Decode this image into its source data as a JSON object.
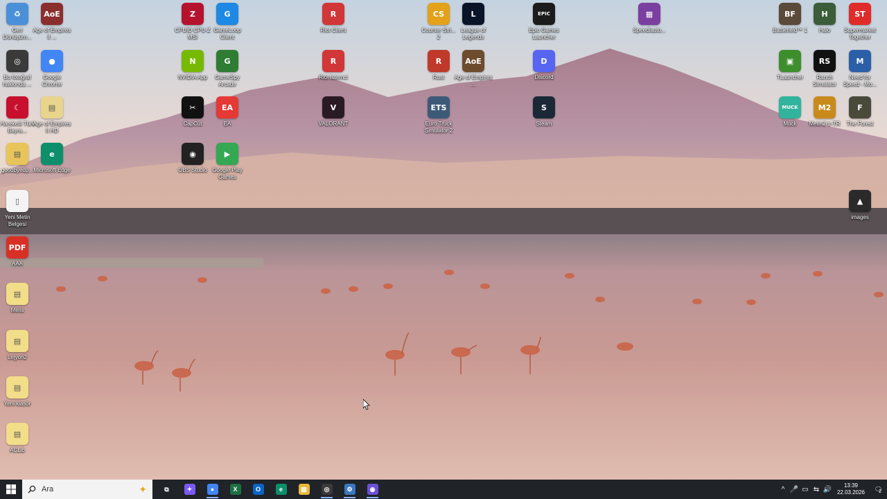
{
  "desktop_icons": [
    {
      "label": "Geri Dönüşüm...",
      "glyph": "♻",
      "color": "#4a90d9"
    },
    {
      "label": "Age of Empires II ...",
      "glyph": "AoE",
      "color": "#8b2e2e"
    },
    {
      "label": "CPUID CPU-Z MSI",
      "glyph": "Z",
      "color": "#b5122e"
    },
    {
      "label": "GameLoop Client",
      "glyph": "G",
      "color": "#1e88e5"
    },
    {
      "label": "Riot Client",
      "glyph": "R",
      "color": "#d13639"
    },
    {
      "label": "Counter Stri... 2",
      "glyph": "CS",
      "color": "#e3a21a"
    },
    {
      "label": "League of Legends",
      "glyph": "L",
      "color": "#0a1428"
    },
    {
      "label": "Epic Games Launcher",
      "glyph": "EPIC",
      "color": "#1b1b1b"
    },
    {
      "label": "Speedlauto...",
      "glyph": "▦",
      "color": "#7b3fa0"
    },
    {
      "label": "Battlefield™ 1",
      "glyph": "BF",
      "color": "#5b4a3a"
    },
    {
      "label": "Halo",
      "glyph": "H",
      "color": "#3b5d3a"
    },
    {
      "label": "Supermarket Together",
      "glyph": "ST",
      "color": "#e02b2b"
    },
    {
      "label": "Bu fotoğraf hakkında ...",
      "glyph": "◎",
      "color": "#3a3a3a"
    },
    {
      "label": "Google Chrome",
      "glyph": "●",
      "color": "#4285f4"
    },
    {
      "label": "NVIDIA App",
      "glyph": "N",
      "color": "#76b900"
    },
    {
      "label": "GameSpy Arcade",
      "glyph": "G",
      "color": "#2e7d32"
    },
    {
      "label": "Riot Istemci",
      "glyph": "R",
      "color": "#d13639"
    },
    {
      "label": "Rust",
      "glyph": "R",
      "color": "#c0392b"
    },
    {
      "label": "Age of Empires ...",
      "glyph": "AoE",
      "color": "#6d4c2e"
    },
    {
      "label": "Discord",
      "glyph": "D",
      "color": "#5865f2"
    },
    {
      "label": "TLauncher",
      "glyph": "▣",
      "color": "#3e8e2e"
    },
    {
      "label": "Ranch Simulator",
      "glyph": "RS",
      "color": "#111111"
    },
    {
      "label": "Need for Speed - Mo...",
      "glyph": "M",
      "color": "#2b5fa8"
    },
    {
      "label": "Hareketli Türk Bayra...",
      "glyph": "☾",
      "color": "#c8102e"
    },
    {
      "label": "Age of Empires II HD",
      "glyph": "▤",
      "color": "#e8d48b"
    },
    {
      "label": "CapCut",
      "glyph": "✂",
      "color": "#111111"
    },
    {
      "label": "EA",
      "glyph": "EA",
      "color": "#e53935"
    },
    {
      "label": "VALORANT",
      "glyph": "V",
      "color": "#2a1a24"
    },
    {
      "label": "Euro Truck Simulator 2",
      "glyph": "ETS",
      "color": "#3c5a78"
    },
    {
      "label": "Steam",
      "glyph": "S",
      "color": "#1b2838"
    },
    {
      "label": "Muck",
      "glyph": "MUCK",
      "color": "#31b39d"
    },
    {
      "label": "Metin2-tr-TR",
      "glyph": "M2",
      "color": "#c98a1c"
    },
    {
      "label": "The Forest",
      "glyph": "F",
      "color": "#4a4a3a"
    },
    {
      "label": "goodbyedp...",
      "glyph": "▤",
      "color": "#e8c55a"
    },
    {
      "label": "Microsoft Edge",
      "glyph": "e",
      "color": "#0c8f6a"
    },
    {
      "label": "OBS Studio",
      "glyph": "◉",
      "color": "#222222"
    },
    {
      "label": "Google Play Games",
      "glyph": "▶",
      "color": "#34a853"
    },
    {
      "label": "Yeni Metin Belgesi",
      "glyph": "▯",
      "color": "#f4f4f4"
    },
    {
      "label": "images",
      "glyph": "▲",
      "color": "#2a2a2a"
    },
    {
      "label": "AAA",
      "glyph": "PDF",
      "color": "#d93025"
    },
    {
      "label": "Melis",
      "glyph": "▤",
      "color": "#f2dd88"
    },
    {
      "label": "Lejyon2",
      "glyph": "▤",
      "color": "#f2dd88"
    },
    {
      "label": "Yeni klasör",
      "glyph": "▤",
      "color": "#f2dd88"
    },
    {
      "label": "ACLib",
      "glyph": "▤",
      "color": "#f2dd88"
    }
  ],
  "taskbar": {
    "search_placeholder": "Ara",
    "apps": [
      {
        "name": "task-view",
        "glyph": "⧉",
        "color": "#202328",
        "active": false
      },
      {
        "name": "copilot",
        "glyph": "✦",
        "color": "#7a5af8",
        "active": false
      },
      {
        "name": "chrome",
        "glyph": "●",
        "color": "#4285f4",
        "active": true
      },
      {
        "name": "excel",
        "glyph": "X",
        "color": "#1d6f42",
        "active": false
      },
      {
        "name": "outlook",
        "glyph": "O",
        "color": "#0a64c8",
        "active": false
      },
      {
        "name": "edge",
        "glyph": "e",
        "color": "#0c8f6a",
        "active": false
      },
      {
        "name": "file-explorer",
        "glyph": "▤",
        "color": "#e8b93a",
        "active": false
      },
      {
        "name": "app-red",
        "glyph": "◎",
        "color": "#3a3a3a",
        "active": true
      },
      {
        "name": "app-settings",
        "glyph": "⚙",
        "color": "#3a78c2",
        "active": true
      },
      {
        "name": "app-chat",
        "glyph": "◉",
        "color": "#6b4fd8",
        "active": true
      }
    ],
    "tray_icons": [
      "^",
      "🎤",
      "▭",
      "⇆",
      "🔊"
    ],
    "time": "13:39",
    "date": "22.03.2026",
    "notification_count": "2"
  },
  "colors": {
    "taskbar": "#202328",
    "sky_top": "#ccd8e3",
    "lake": "#d0a69c"
  }
}
